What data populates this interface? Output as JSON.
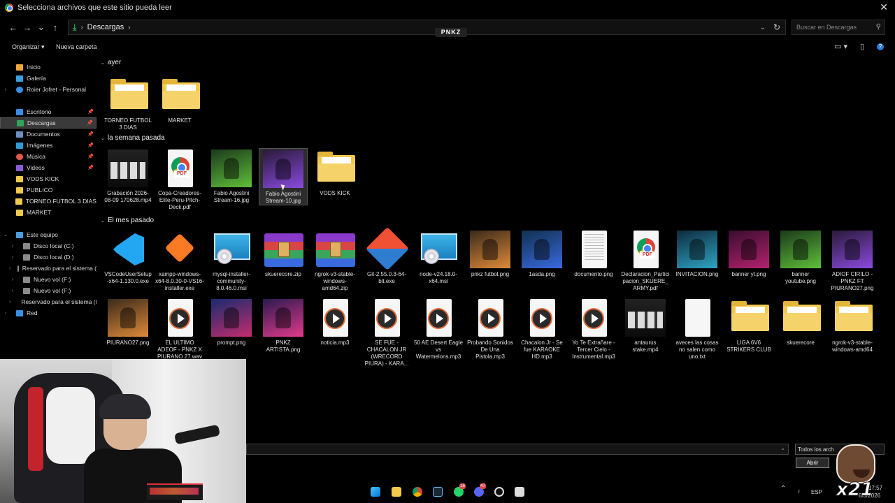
{
  "titlebar": {
    "title": "Selecciona archivos que este sitio pueda leer",
    "close": "✕"
  },
  "nav": {
    "back": "←",
    "forward": "→",
    "recent": "⌄",
    "up": "↑",
    "crumb_sep1": "›",
    "location": "Descargas",
    "crumb_sep2": "›",
    "addr_chev": "⌄",
    "refresh": "↻",
    "search_placeholder": "Buscar en Descargas",
    "brand": "PNKZ"
  },
  "toolbar": {
    "organize": "Organizar ▾",
    "new_folder": "Nueva carpeta",
    "view": "▭ ▾",
    "preview": "▯",
    "help": "?"
  },
  "sidebar": [
    {
      "label": "Inicio",
      "icon": "home-icon",
      "tw": "",
      "pin": false
    },
    {
      "label": "Galería",
      "icon": "gallery-icon",
      "tw": "",
      "pin": false
    },
    {
      "label": "Roier Jofret - Personal",
      "icon": "cloud-icon",
      "tw": "›",
      "pin": false
    },
    {
      "label": "Escritorio",
      "icon": "desktop-icon",
      "tw": "",
      "pin": true
    },
    {
      "label": "Descargas",
      "icon": "download-icon",
      "tw": "",
      "pin": true,
      "selected": true
    },
    {
      "label": "Documentos",
      "icon": "documents-icon",
      "tw": "",
      "pin": true
    },
    {
      "label": "Imágenes",
      "icon": "images-icon",
      "tw": "",
      "pin": true
    },
    {
      "label": "Música",
      "icon": "music-icon",
      "tw": "",
      "pin": true
    },
    {
      "label": "Videos",
      "icon": "videos-icon",
      "tw": "",
      "pin": true
    },
    {
      "label": "VODS KICK",
      "icon": "folder-icon",
      "tw": "",
      "pin": false
    },
    {
      "label": "PUBLICO",
      "icon": "folder-icon",
      "tw": "",
      "pin": false
    },
    {
      "label": "TORNEO FUTBOL 3 DIAS",
      "icon": "folder-icon",
      "tw": "",
      "pin": false
    },
    {
      "label": "MARKET",
      "icon": "folder-icon",
      "tw": "",
      "pin": false
    },
    {
      "label": "Este equipo",
      "icon": "pc-icon",
      "tw": "⌄",
      "pin": false
    },
    {
      "label": "Disco local (C:)",
      "icon": "disk-icon",
      "tw": "›",
      "pin": false
    },
    {
      "label": "Disco local (D:)",
      "icon": "disk-icon",
      "tw": "›",
      "pin": false
    },
    {
      "label": "Reservado para el sistema (",
      "icon": "disk-icon",
      "tw": "›",
      "pin": false
    },
    {
      "label": "Nuevo vol (F:)",
      "icon": "disk-icon",
      "tw": "›",
      "pin": false
    },
    {
      "label": "Nuevo vol (F:)",
      "icon": "disk-icon",
      "tw": "›",
      "pin": false
    },
    {
      "label": "Reservado para el sistema (E:",
      "icon": "disk-icon",
      "tw": "›",
      "pin": false
    },
    {
      "label": "Red",
      "icon": "network-icon",
      "tw": "›",
      "pin": false
    }
  ],
  "groups": {
    "ayer": "ayer",
    "semana": "la semana pasada",
    "mes": "El mes pasado"
  },
  "files": {
    "ayer": [
      {
        "name": "TORNEO FUTBOL 3 DIAS",
        "type": "folder"
      },
      {
        "name": "MARKET",
        "type": "folder"
      }
    ],
    "semana": [
      {
        "name": "Grabación 2026-08-09 170628.mp4",
        "type": "video"
      },
      {
        "name": "Copa-Creadores-Elite-Peru-Pitch-Deck.pdf",
        "type": "pdf"
      },
      {
        "name": "Fabio Agostini Stream-16.jpg",
        "type": "photo"
      },
      {
        "name": "Fabio Agostini Stream-10.jpg",
        "type": "photo",
        "selected": true
      },
      {
        "name": "VODS KICK",
        "type": "folder"
      }
    ],
    "mes1": [
      {
        "name": "VSCodeUserSetup-x64-1.130.0.exe",
        "type": "vscode"
      },
      {
        "name": "xampp-windows-x64-8.0.30-0-VS16-installer.exe",
        "type": "xampp"
      },
      {
        "name": "mysql-installer-community-8.0.46.0.msi",
        "type": "installer"
      },
      {
        "name": "skuerecore.zip",
        "type": "zip"
      },
      {
        "name": "ngrok-v3-stable-windows-amd64.zip",
        "type": "zip"
      },
      {
        "name": "Git-2.55.0.3-64-bit.exe",
        "type": "git"
      },
      {
        "name": "node-v24.18.0-x64.msi",
        "type": "installer"
      },
      {
        "name": "pnkz futbol.png",
        "type": "photo"
      },
      {
        "name": "1asda.png",
        "type": "photo"
      },
      {
        "name": "documento.png",
        "type": "doc"
      },
      {
        "name": "Declaracion_Participacion_SKUERE_ARMY.pdf",
        "type": "pdf"
      },
      {
        "name": "INVITACION.png",
        "type": "photo"
      },
      {
        "name": "banner yt.png",
        "type": "photo"
      },
      {
        "name": "banner youtube.png",
        "type": "photo"
      },
      {
        "name": "ADIOF CIRILO - PNKZ FT PIURANO27.png",
        "type": "photo"
      }
    ],
    "mes2": [
      {
        "name": "PIURANO27.png",
        "type": "photo"
      },
      {
        "name": "EL ULTIMO ADEOF - PNKZ X PIURANO 27.wav",
        "type": "audio"
      },
      {
        "name": "prompt.png",
        "type": "photo"
      },
      {
        "name": "PNKZ ARTISTA.png",
        "type": "photo"
      },
      {
        "name": "noticia.mp3",
        "type": "audio"
      },
      {
        "name": "SE FUE - CHACALON JR (WRECORD PIURA) - KARA...",
        "type": "audio"
      },
      {
        "name": "50 AE Desert Eagle vs Watermelons.mp3",
        "type": "audio"
      },
      {
        "name": "Probando Sonidos De Una Pistola.mp3",
        "type": "audio"
      },
      {
        "name": "Chacalon Jr - Se fue KARAOKE HD.mp3",
        "type": "audio"
      },
      {
        "name": "Yo Te Extrañare - Tercer Cielo - Instrumental.mp3",
        "type": "audio"
      },
      {
        "name": "antaurus stake.mp4",
        "type": "video"
      },
      {
        "name": "aveces las cosas no salen como uno.txt",
        "type": "txt"
      },
      {
        "name": "LIGA 6V6 STRIKERS CLUB",
        "type": "folder"
      },
      {
        "name": "skuerecore",
        "type": "folder"
      },
      {
        "name": "ngrok-v3-stable-windows-amd64",
        "type": "folder"
      }
    ]
  },
  "bottom": {
    "filetype": "Todos los arch",
    "open": "Abrir"
  },
  "taskbar": {
    "lang": "ESP",
    "time": "17:57",
    "date": "6/3/2026",
    "badge_wa": "16",
    "badge_disc": "47"
  },
  "sticker": {
    "label": "x21"
  },
  "colors": {
    "background": "#000000",
    "selection": "#3a3a3a",
    "folder": "#f2c94c",
    "accent": "#2d7cd6"
  }
}
